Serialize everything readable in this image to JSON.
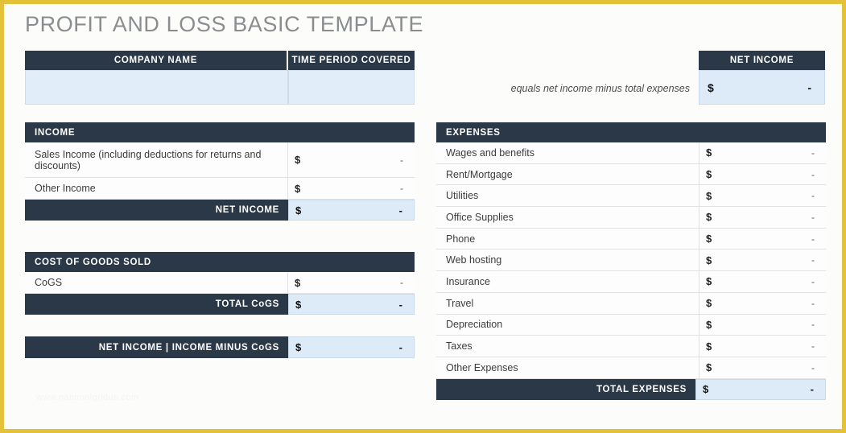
{
  "page": {
    "title": "PROFIT AND LOSS BASIC TEMPLATE",
    "watermark": "www.nationalgridus.com",
    "colors": {
      "header_navy": "#2b3847",
      "highlight_blue": "#ddeaf7",
      "input_blue": "#e1edf9",
      "border_gold": "#e3c23a",
      "title_gray": "#8a8d8f"
    }
  },
  "company_block": {
    "company_name_header": "COMPANY NAME",
    "time_period_header": "TIME PERIOD COVERED",
    "company_name_value": "",
    "time_period_value": ""
  },
  "net_income_callout": {
    "note": "equals net income minus total expenses",
    "header": "NET INCOME",
    "currency": "$",
    "value": "-"
  },
  "income": {
    "header": "INCOME",
    "rows": [
      {
        "label": "Sales Income (including deductions for returns and discounts)",
        "currency": "$",
        "value": "-"
      },
      {
        "label": "Other  Income",
        "currency": "$",
        "value": "-"
      }
    ],
    "total": {
      "label": "NET INCOME",
      "currency": "$",
      "value": "-"
    }
  },
  "cogs": {
    "header": "COST OF GOODS SOLD",
    "rows": [
      {
        "label": "CoGS",
        "currency": "$",
        "value": "-"
      }
    ],
    "total": {
      "label": "TOTAL CoGS",
      "currency": "$",
      "value": "-"
    }
  },
  "net_income_minus_cogs": {
    "label": "NET INCOME  |  INCOME MINUS CoGS",
    "currency": "$",
    "value": "-"
  },
  "expenses": {
    "header": "EXPENSES",
    "rows": [
      {
        "label": "Wages and benefits",
        "currency": "$",
        "value": "-"
      },
      {
        "label": "Rent/Mortgage",
        "currency": "$",
        "value": "-"
      },
      {
        "label": "Utilities",
        "currency": "$",
        "value": "-"
      },
      {
        "label": "Office Supplies",
        "currency": "$",
        "value": "-"
      },
      {
        "label": "Phone",
        "currency": "$",
        "value": "-"
      },
      {
        "label": "Web hosting",
        "currency": "$",
        "value": "-"
      },
      {
        "label": "Insurance",
        "currency": "$",
        "value": "-"
      },
      {
        "label": "Travel",
        "currency": "$",
        "value": "-"
      },
      {
        "label": "Depreciation",
        "currency": "$",
        "value": "-"
      },
      {
        "label": "Taxes",
        "currency": "$",
        "value": "-"
      },
      {
        "label": "Other Expenses",
        "currency": "$",
        "value": "-"
      }
    ],
    "total": {
      "label": "TOTAL EXPENSES",
      "currency": "$",
      "value": "-"
    }
  }
}
